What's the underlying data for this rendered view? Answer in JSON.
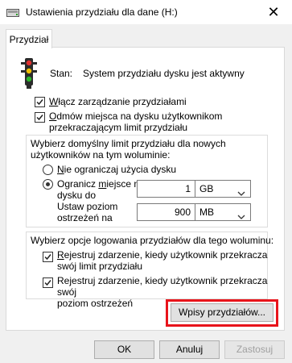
{
  "window": {
    "title": "Ustawienia przydziału dla dane (H:)"
  },
  "tab": {
    "label": "Przydział"
  },
  "status": {
    "label": "Stan:",
    "value": "System przydziału dysku jest aktywny"
  },
  "options": {
    "enable_quota": {
      "label_pre": "",
      "label_u": "W",
      "label_post": "łącz zarządzanie przydziałami",
      "checked": true
    },
    "deny_space": {
      "line1_u": "O",
      "line1_post": "dmów miejsca na dysku użytkownikom",
      "line2": "przekraczającym limit przydziału",
      "checked": true
    }
  },
  "default_limit": {
    "heading_line1": "Wybierz domyślny limit przydziału dla nowych",
    "heading_line2": "użytkowników na tym woluminie:",
    "no_limit": {
      "label_u": "N",
      "label_post": "ie ograniczaj użycia dysku",
      "selected": false
    },
    "limit": {
      "label_line1_pre": "Ogranicz ",
      "label_line1_u": "m",
      "label_line1_post": "iejsce na",
      "label_line2": "dysku do",
      "selected": true,
      "value": "1",
      "unit": "GB"
    },
    "warning": {
      "label_line1": "Ustaw poziom",
      "label_line2": "ostrzeżeń na",
      "value": "900",
      "unit": "MB"
    }
  },
  "logging": {
    "heading": "Wybierz opcje logowania przydziałów dla tego woluminu:",
    "exceed_limit": {
      "line1_u": "R",
      "line1_post": "ejestruj zdarzenie, kiedy użytkownik przekracza",
      "line2": "swój limit przydziału",
      "checked": true
    },
    "exceed_warning": {
      "line1_pre": "Re",
      "line1_u": "j",
      "line1_post": "estruj zdarzenie, kiedy użytkownik przekracza swój",
      "line2": "poziom ostrzeżeń",
      "checked": true
    }
  },
  "buttons": {
    "entries": "Wpisy przydziałów...",
    "ok": "OK",
    "cancel": "Anuluj",
    "apply": "Zastosuj"
  },
  "colors": {
    "highlight": "#e8141b"
  },
  "icons": {
    "title": "drive-icon",
    "status": "traffic-light-icon"
  }
}
